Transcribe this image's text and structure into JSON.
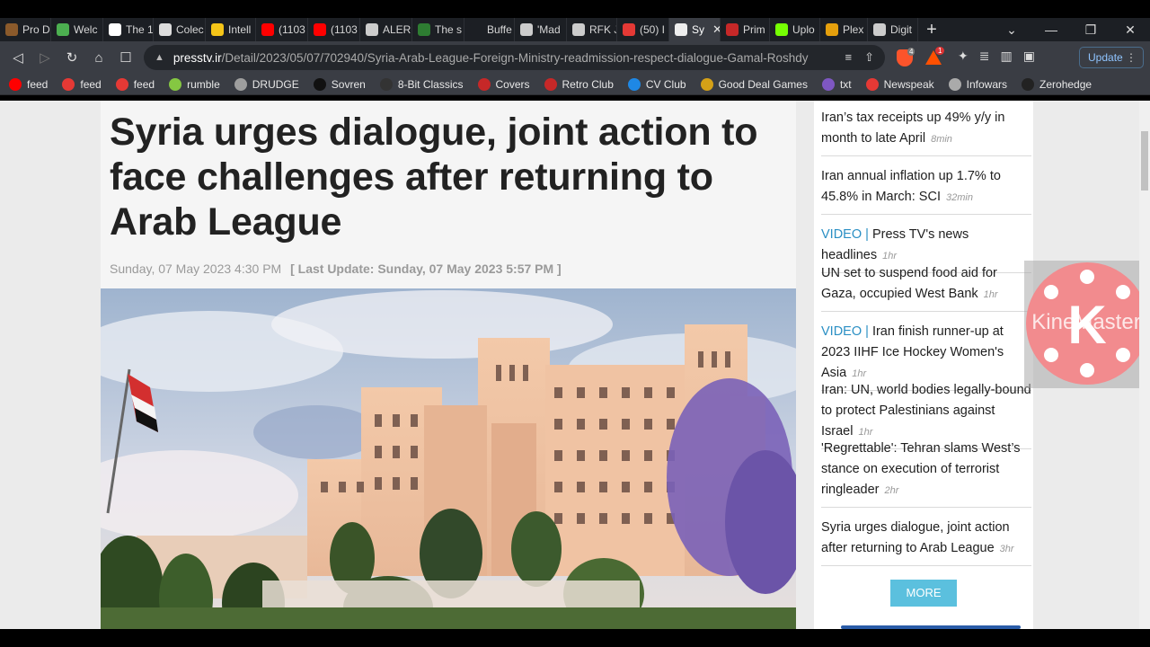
{
  "browser": {
    "tabs": [
      {
        "label": "Pro D",
        "color": "#8b5a2b"
      },
      {
        "label": "Welc",
        "color": "#4caf50"
      },
      {
        "label": "The 1",
        "color": "#ffffff"
      },
      {
        "label": "Colec",
        "color": "#dddddd"
      },
      {
        "label": "Intell",
        "color": "#f5c518"
      },
      {
        "label": "(1103",
        "color": "#ff0000"
      },
      {
        "label": "(1103",
        "color": "#ff0000"
      },
      {
        "label": "ALER",
        "color": "#cccccc"
      },
      {
        "label": "The s",
        "color": "#2e7d32"
      },
      {
        "label": "Buffe",
        "color": "#1c1f24"
      },
      {
        "label": "'Mad",
        "color": "#cccccc"
      },
      {
        "label": "RFK J",
        "color": "#cccccc"
      },
      {
        "label": "(50) I",
        "color": "#e53935"
      },
      {
        "label": "Sy",
        "color": "#eeeeee",
        "active": true
      },
      {
        "label": "Prim",
        "color": "#c62828"
      },
      {
        "label": "Uplo",
        "color": "#76ff03"
      },
      {
        "label": "Plex",
        "color": "#e5a00d"
      },
      {
        "label": "Digit",
        "color": "#cccccc"
      }
    ],
    "new_tab": "+",
    "window_controls": {
      "dropdown": "⌄",
      "minimize": "—",
      "restore": "❐",
      "close": "✕"
    },
    "url_host": "presstv.ir",
    "url_path": "/Detail/2023/05/07/702940/Syria-Arab-League-Foreign-Ministry-readmission-respect-dialogue-Gamal-Roshdy",
    "brave_badge": "4",
    "bat_badge": "1",
    "update_label": "Update",
    "update_more": "⋮",
    "bookmarks": [
      {
        "label": "feed",
        "color": "#ff0000"
      },
      {
        "label": "feed",
        "color": "#e53935"
      },
      {
        "label": "feed",
        "color": "#e53935"
      },
      {
        "label": "rumble",
        "color": "#85c742"
      },
      {
        "label": "DRUDGE",
        "color": "#9e9e9e"
      },
      {
        "label": "Sovren",
        "color": "#111111"
      },
      {
        "label": "8-Bit Classics",
        "color": "#333333"
      },
      {
        "label": "Covers",
        "color": "#c62828"
      },
      {
        "label": "Retro Club",
        "color": "#c62828"
      },
      {
        "label": "CV Club",
        "color": "#1e88e5"
      },
      {
        "label": "Good Deal Games",
        "color": "#d4a017"
      },
      {
        "label": "txt",
        "color": "#7e57c2"
      },
      {
        "label": "Newspeak",
        "color": "#e53935"
      },
      {
        "label": "Infowars",
        "color": "#aaaaaa"
      },
      {
        "label": "Zerohedge",
        "color": "#222222"
      }
    ]
  },
  "article": {
    "headline": "Syria urges dialogue, joint action to face challenges after returning to Arab League",
    "date": "Sunday, 07 May 2023 4:30 PM",
    "last_update": "[ Last Update: Sunday, 07 May 2023 5:57 PM ]"
  },
  "sidebar": {
    "items": [
      {
        "tag": "",
        "title": "Iran’s tax receipts up 49% y/y in month to late April",
        "ago": "8min"
      },
      {
        "tag": "",
        "title": "Iran annual inflation up 1.7% to 45.8% in March: SCI",
        "ago": "32min"
      },
      {
        "tag": "VIDEO |",
        "title": "Press TV's news headlines",
        "ago": "1hr"
      },
      {
        "tag": "",
        "title": "UN set to suspend food aid for Gaza, occupied West Bank",
        "ago": "1hr"
      },
      {
        "tag": "VIDEO |",
        "title": "Iran finish runner-up at 2023 IIHF Ice Hockey Women's Asia",
        "ago": "1hr"
      },
      {
        "tag": "",
        "title": "Iran: UN, world bodies legally-bound to protect Palestinians against Israel",
        "ago": "1hr"
      },
      {
        "tag": "",
        "title": "'Regrettable': Tehran slams West’s stance on execution of terrorist ringleader",
        "ago": "2hr"
      },
      {
        "tag": "",
        "title": "Syria urges dialogue, joint action after returning to Arab League",
        "ago": "3hr"
      }
    ],
    "more_label": "MORE"
  },
  "watermark": {
    "letter": "K",
    "text": "KineMaster"
  }
}
